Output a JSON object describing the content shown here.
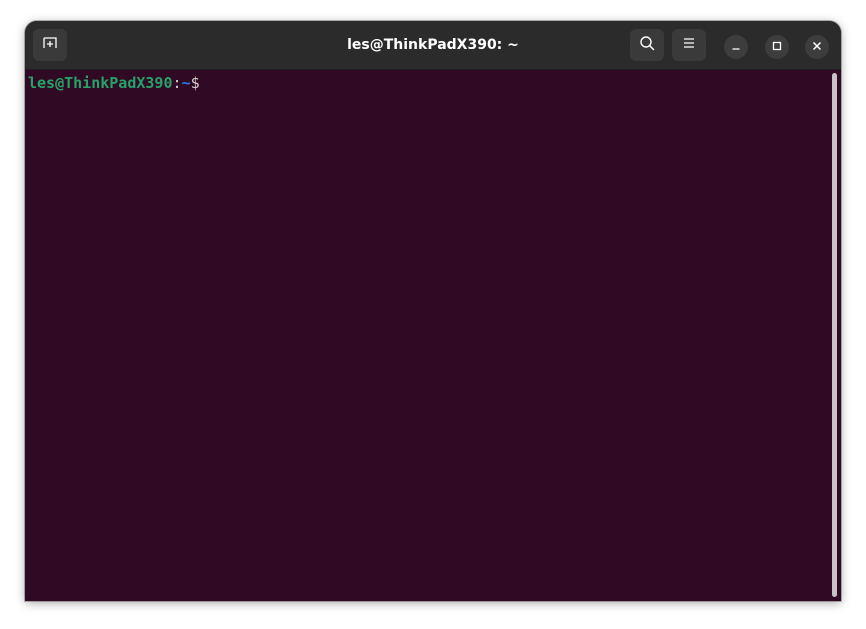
{
  "window": {
    "title": "les@ThinkPadX390: ~"
  },
  "titlebar": {
    "new_tab_icon": "new-tab-icon",
    "search_icon": "search-icon",
    "menu_icon": "hamburger-menu-icon",
    "minimize_icon": "minimize-icon",
    "maximize_icon": "maximize-icon",
    "close_icon": "close-icon"
  },
  "terminal": {
    "prompt": {
      "user_host": "les@ThinkPadX390",
      "colon": ":",
      "path": "~",
      "symbol": "$"
    },
    "background": "#300a24"
  },
  "colors": {
    "titlebar": "#2b2b2b",
    "prompt_user": "#26a269",
    "prompt_path": "#2a7bde",
    "text": "#d0cfcc"
  }
}
